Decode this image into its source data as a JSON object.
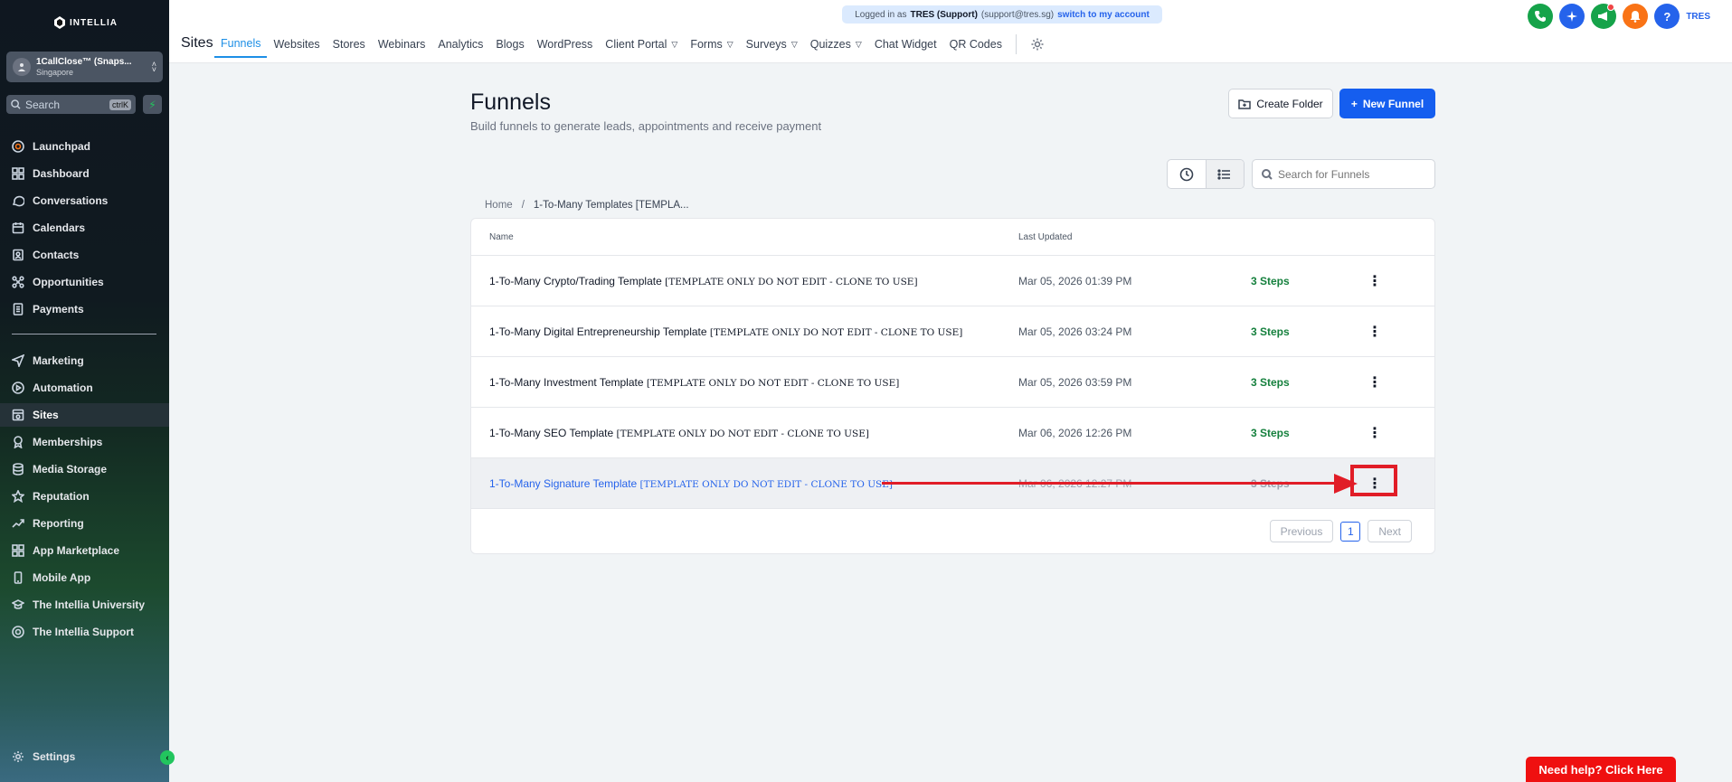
{
  "app": {
    "logo_text": "INTELLIA"
  },
  "account": {
    "name": "1CallClose™ (Snaps...",
    "location": "Singapore"
  },
  "sidebar_search": {
    "placeholder": "Search",
    "shortcut": "ctrlK"
  },
  "sidebar": {
    "items": [
      {
        "label": "Launchpad",
        "icon": "launchpad-icon"
      },
      {
        "label": "Dashboard",
        "icon": "dashboard-icon"
      },
      {
        "label": "Conversations",
        "icon": "chat-icon"
      },
      {
        "label": "Calendars",
        "icon": "calendar-icon"
      },
      {
        "label": "Contacts",
        "icon": "contacts-icon"
      },
      {
        "label": "Opportunities",
        "icon": "opportunities-icon"
      },
      {
        "label": "Payments",
        "icon": "payments-icon"
      },
      {
        "label": "Marketing",
        "icon": "send-icon"
      },
      {
        "label": "Automation",
        "icon": "automation-icon"
      },
      {
        "label": "Sites",
        "icon": "sites-icon",
        "active": true
      },
      {
        "label": "Memberships",
        "icon": "award-icon"
      },
      {
        "label": "Media Storage",
        "icon": "database-icon"
      },
      {
        "label": "Reputation",
        "icon": "star-icon"
      },
      {
        "label": "Reporting",
        "icon": "trend-icon"
      },
      {
        "label": "App Marketplace",
        "icon": "grid-icon"
      },
      {
        "label": "Mobile App",
        "icon": "phone-icon"
      },
      {
        "label": "The Intellia University",
        "icon": "graduation-icon"
      },
      {
        "label": "The Intellia Support",
        "icon": "support-icon"
      }
    ],
    "settings_label": "Settings"
  },
  "header": {
    "section_title": "Sites",
    "tabs": [
      {
        "label": "Funnels",
        "active": true
      },
      {
        "label": "Websites"
      },
      {
        "label": "Stores"
      },
      {
        "label": "Webinars"
      },
      {
        "label": "Analytics"
      },
      {
        "label": "Blogs"
      },
      {
        "label": "WordPress"
      },
      {
        "label": "Client Portal",
        "dropdown": true
      },
      {
        "label": "Forms",
        "dropdown": true
      },
      {
        "label": "Surveys",
        "dropdown": true
      },
      {
        "label": "Quizzes",
        "dropdown": true
      },
      {
        "label": "Chat Widget"
      },
      {
        "label": "QR Codes"
      }
    ],
    "impersonation": {
      "prefix": "Logged in as",
      "user": "TRES (Support)",
      "email": "(support@tres.sg)",
      "switch_label": "switch to my account"
    },
    "user_initials": "TRES",
    "icon_colors": {
      "phone": "#16a34a",
      "ai": "#2563eb",
      "announce": "#16a34a",
      "bell": "#f97316",
      "help": "#2563eb"
    }
  },
  "main": {
    "title": "Funnels",
    "subtitle": "Build funnels to generate leads, appointments and receive payment",
    "create_folder_label": "Create Folder",
    "new_funnel_label": "New Funnel",
    "search_placeholder": "Search for Funnels",
    "breadcrumb": {
      "home": "Home",
      "separator": "/",
      "current": "1-To-Many Templates [TEMPLA..."
    },
    "table": {
      "columns": [
        "Name",
        "Last Updated"
      ],
      "rows": [
        {
          "title": "1-To-Many Crypto/Trading Template",
          "tag": "[TEMPLATE ONLY DO NOT EDIT - CLONE TO USE]",
          "updated": "Mar 05, 2026 01:39 PM",
          "steps": "3 Steps"
        },
        {
          "title": "1-To-Many Digital Entrepreneurship Template",
          "tag": "[TEMPLATE ONLY DO NOT EDIT - CLONE TO USE]",
          "updated": "Mar 05, 2026 03:24 PM",
          "steps": "3 Steps"
        },
        {
          "title": "1-To-Many Investment Template",
          "tag": "[TEMPLATE ONLY DO NOT EDIT - CLONE TO USE]",
          "updated": "Mar 05, 2026 03:59 PM",
          "steps": "3 Steps"
        },
        {
          "title": "1-To-Many SEO Template",
          "tag": "[TEMPLATE ONLY DO NOT EDIT - CLONE TO USE]",
          "updated": "Mar 06, 2026 12:26 PM",
          "steps": "3 Steps"
        },
        {
          "title": "1-To-Many Signature Template",
          "tag": "[TEMPLATE ONLY DO NOT EDIT - CLONE TO USE]",
          "updated": "Mar 06, 2026 12:27 PM",
          "steps": "3 Steps",
          "highlighted": true
        }
      ]
    },
    "pagination": {
      "previous": "Previous",
      "page": "1",
      "next": "Next"
    }
  },
  "help_button": "Need help? Click Here",
  "annotation_color": "#e11d27"
}
